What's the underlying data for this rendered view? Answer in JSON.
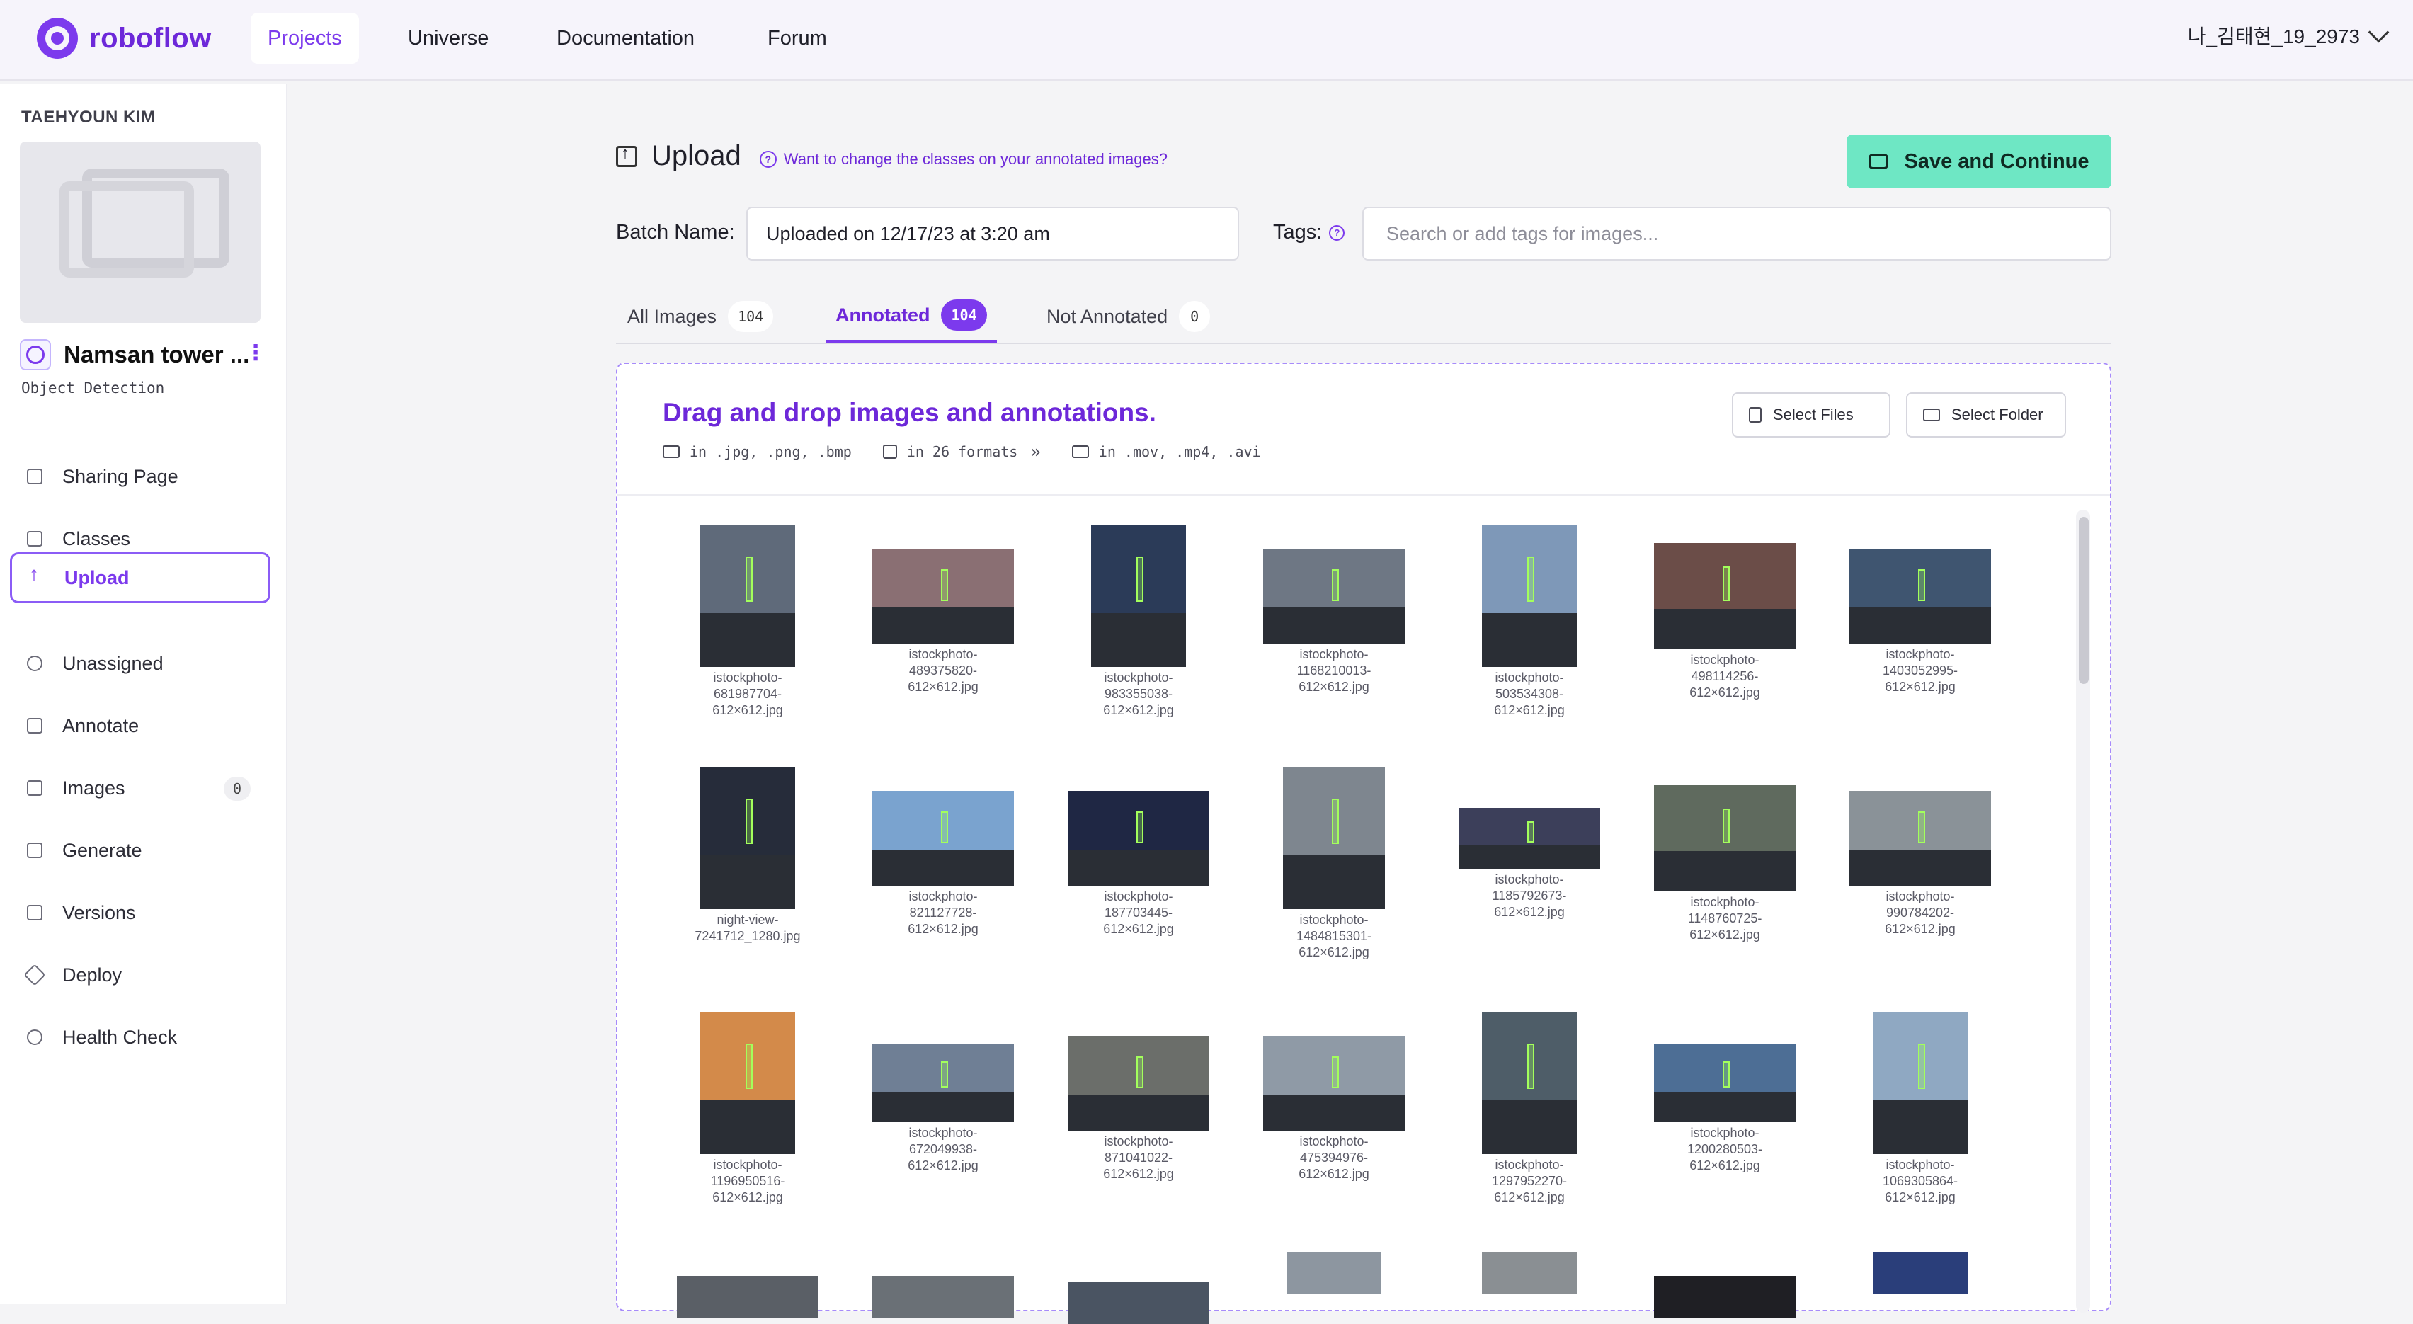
{
  "topnav": {
    "logo_text": "roboflow",
    "tabs": [
      "Projects",
      "Universe",
      "Documentation",
      "Forum"
    ],
    "active_tab": "Projects",
    "user_name": "나_김태현_19_2973"
  },
  "sidebar": {
    "owner": "TAEHYOUN KIM",
    "project_name": "Namsan tower ...",
    "project_type": "Object Detection",
    "items": [
      {
        "label": "Sharing Page",
        "icon": "sharing-page-icon"
      },
      {
        "label": "Classes",
        "icon": "list-icon"
      },
      {
        "label": "Upload",
        "icon": "upload-arrow-icon",
        "active": true
      },
      {
        "label": "Unassigned",
        "icon": "search-icon"
      },
      {
        "label": "Annotate",
        "icon": "annotate-icon"
      },
      {
        "label": "Images",
        "icon": "images-icon",
        "badge": "0"
      },
      {
        "label": "Generate",
        "icon": "generate-icon"
      },
      {
        "label": "Versions",
        "icon": "versions-icon"
      },
      {
        "label": "Deploy",
        "icon": "rocket-icon"
      },
      {
        "label": "Health Check",
        "icon": "heart-icon"
      }
    ]
  },
  "upload": {
    "title": "Upload",
    "help_link": "Want to change the classes on your annotated images?",
    "save_button": "Save and Continue",
    "batch_label": "Batch Name:",
    "batch_value": "Uploaded on 12/17/23 at 3:20 am",
    "tags_label": "Tags:",
    "tags_placeholder": "Search or add tags for images..."
  },
  "tabs": [
    {
      "label": "All Images",
      "count": "104"
    },
    {
      "label": "Annotated",
      "count": "104",
      "active": true
    },
    {
      "label": "Not Annotated",
      "count": "0"
    }
  ],
  "dropzone": {
    "title": "Drag and drop images and annotations.",
    "formats_images": "in .jpg, .png, .bmp",
    "formats_annotations": "in 26 formats",
    "formats_video": "in .mov, .mp4, .avi",
    "select_files": "Select Files",
    "select_folder": "Select Folder"
  },
  "images": [
    [
      "istockphoto-",
      "681987704-",
      "612×612.jpg"
    ],
    [
      "istockphoto-",
      "489375820-",
      "612×612.jpg"
    ],
    [
      "istockphoto-",
      "983355038-",
      "612×612.jpg"
    ],
    [
      "istockphoto-",
      "1168210013-",
      "612×612.jpg"
    ],
    [
      "istockphoto-",
      "503534308-",
      "612×612.jpg"
    ],
    [
      "istockphoto-",
      "498114256-",
      "612×612.jpg"
    ],
    [
      "istockphoto-",
      "1403052995-",
      "612×612.jpg"
    ],
    [
      "night-view-",
      "7241712_1280.jpg"
    ],
    [
      "istockphoto-",
      "821127728-",
      "612×612.jpg"
    ],
    [
      "istockphoto-",
      "187703445-",
      "612×612.jpg"
    ],
    [
      "istockphoto-",
      "1484815301-",
      "612×612.jpg"
    ],
    [
      "istockphoto-",
      "1185792673-",
      "612×612.jpg"
    ],
    [
      "istockphoto-",
      "1148760725-",
      "612×612.jpg"
    ],
    [
      "istockphoto-",
      "990784202-",
      "612×612.jpg"
    ],
    [
      "istockphoto-",
      "1196950516-",
      "612×612.jpg"
    ],
    [
      "istockphoto-",
      "672049938-",
      "612×612.jpg"
    ],
    [
      "istockphoto-",
      "871041022-",
      "612×612.jpg"
    ],
    [
      "istockphoto-",
      "475394976-",
      "612×612.jpg"
    ],
    [
      "istockphoto-",
      "1297952270-",
      "612×612.jpg"
    ],
    [
      "istockphoto-",
      "1200280503-",
      "612×612.jpg"
    ],
    [
      "istockphoto-",
      "1069305864-",
      "612×612.jpg"
    ]
  ],
  "colors": {
    "accent": "#7c3aed",
    "save_button": "#6ee7c4",
    "annotation_box": "#a3ff5c"
  }
}
